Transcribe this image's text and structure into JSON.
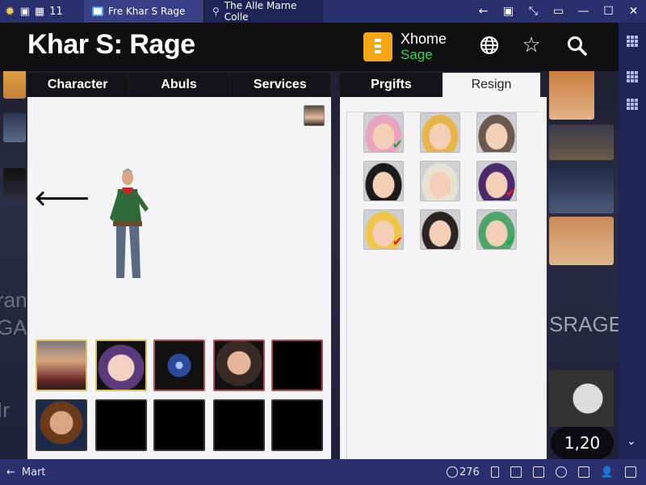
{
  "os_bar": {
    "clock": "11",
    "tabs": [
      {
        "label": "Fre Khar S Rage"
      },
      {
        "label": "The Alle Marne Colle"
      }
    ]
  },
  "game": {
    "title": "Khar S: Rage",
    "profile": {
      "name": "Xhome",
      "status": "Sage"
    },
    "left_tabs": [
      "Character",
      "Abuls",
      "Services"
    ],
    "right_tabs": [
      "Prgifts",
      "Resign"
    ],
    "bg_left_text": [
      "ran",
      "GA",
      "",
      "",
      "",
      "Ir"
    ],
    "bg_right_text": "SRAGE",
    "counter": "1,20"
  },
  "roster_faces": [
    {
      "hair": "#e9a4c0",
      "check": "green"
    },
    {
      "hair": "#e6b64a",
      "check": ""
    },
    {
      "hair": "#6a5a4e",
      "check": ""
    },
    {
      "hair": "#1b1b1b",
      "check": ""
    },
    {
      "hair": "#e8e1d2",
      "check": ""
    },
    {
      "hair": "#4a2a6a",
      "check": "red"
    },
    {
      "hair": "#f0c64a",
      "check": "red"
    },
    {
      "hair": "#2a2422",
      "check": ""
    },
    {
      "hair": "#4aa66a",
      "check": "green"
    }
  ],
  "bottom_bar": {
    "back_label": "Mart",
    "count": "276"
  },
  "colors": {
    "accent": "#2a2f6e",
    "profile_icon": "#f4a617",
    "status_green": "#34d058"
  }
}
